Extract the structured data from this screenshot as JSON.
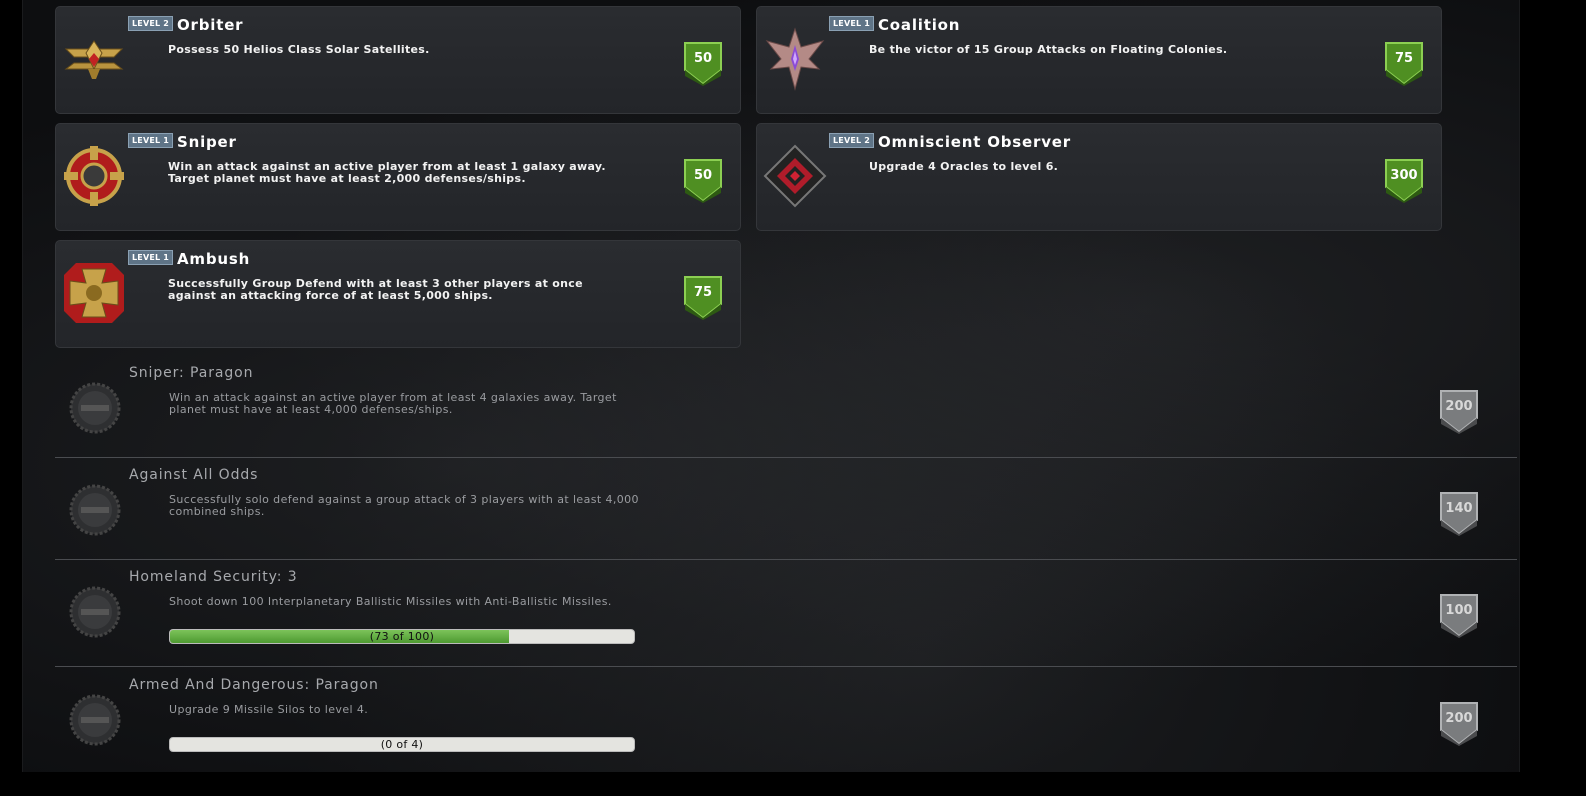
{
  "unlocked": [
    {
      "level": "LEVEL 2",
      "title": "Orbiter",
      "desc": "Possess 50 Helios Class Solar Satellites.",
      "points": "50",
      "icon": "orbiter-icon"
    },
    {
      "level": "LEVEL 1",
      "title": "Coalition",
      "desc": "Be the victor of 15 Group Attacks on Floating Colonies.",
      "points": "75",
      "icon": "coalition-icon"
    },
    {
      "level": "LEVEL 1",
      "title": "Sniper",
      "desc": "Win an attack against an active player from at least 1 galaxy away. Target planet must have at least 2,000 defenses/ships.",
      "points": "50",
      "icon": "sniper-icon"
    },
    {
      "level": "LEVEL 2",
      "title": "Omniscient Observer",
      "desc": "Upgrade 4 Oracles to level 6.",
      "points": "300",
      "icon": "observer-icon"
    },
    {
      "level": "LEVEL 1",
      "title": "Ambush",
      "desc": "Successfully Group Defend with at least 3 other players at once against an attacking force of at least 5,000 ships.",
      "points": "75",
      "icon": "ambush-icon"
    }
  ],
  "locked": [
    {
      "title": "Sniper: Paragon",
      "desc": "Win an attack against an active player from at least 4 galaxies away. Target planet must have at least 4,000 defenses/ships.",
      "points": "200"
    },
    {
      "title": "Against All Odds",
      "desc": "Successfully solo defend against a group attack of 3 players with at least 4,000 combined ships.",
      "points": "140"
    },
    {
      "title": "Homeland Security: 3",
      "desc": "Shoot down 100 Interplanetary Ballistic Missiles with Anti-Ballistic Missiles.",
      "points": "100",
      "progress_text": "(73 of 100)",
      "progress": 0.73
    },
    {
      "title": "Armed And Dangerous: Paragon",
      "desc": "Upgrade 9 Missile Silos to level 4.",
      "points": "200",
      "progress_text": "(0 of 4)",
      "progress": 0.0
    }
  ],
  "colors": {
    "unlocked_shield": "#4f8f22",
    "locked_shield": "#7a7c7e"
  }
}
